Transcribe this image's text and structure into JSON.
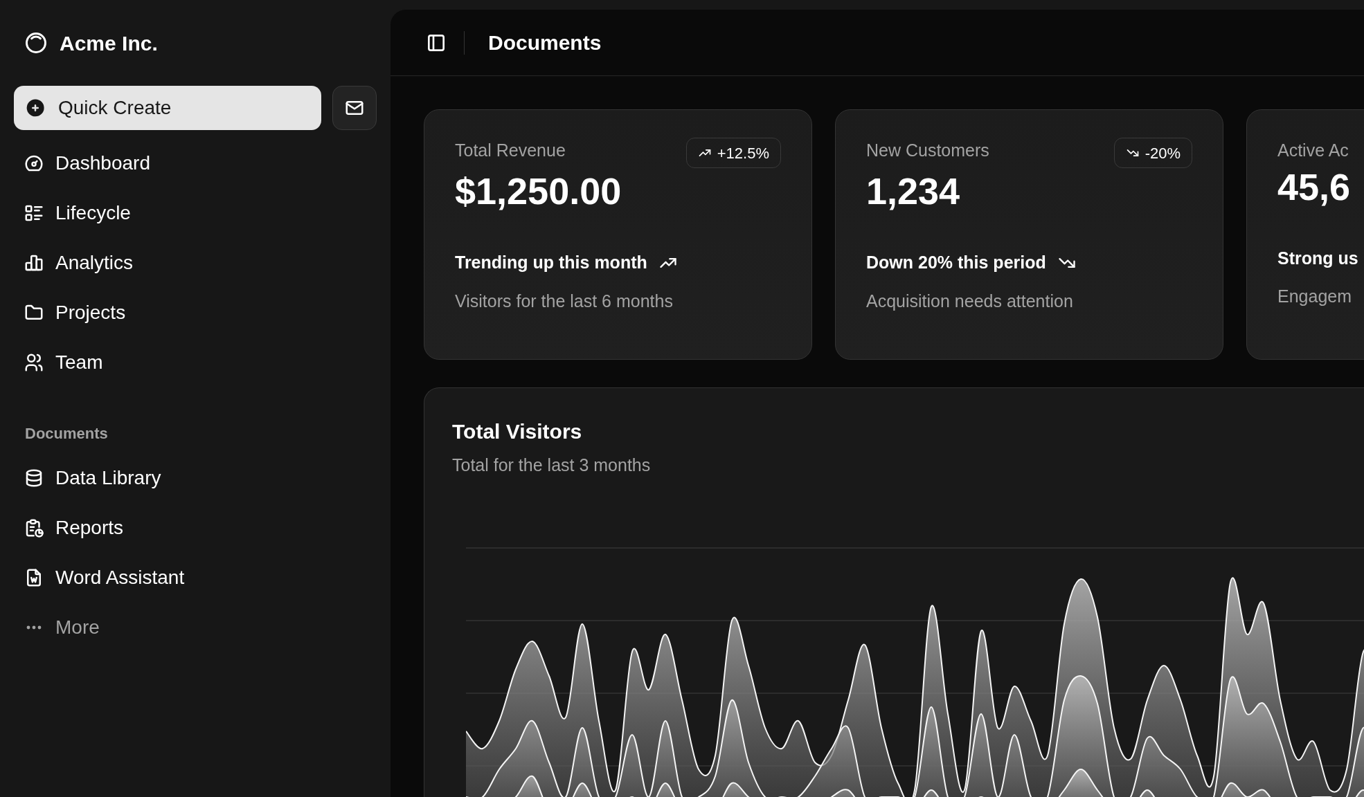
{
  "sidebar": {
    "brand": "Acme Inc.",
    "quick_create": "Quick Create",
    "nav_items": [
      {
        "label": "Dashboard"
      },
      {
        "label": "Lifecycle"
      },
      {
        "label": "Analytics"
      },
      {
        "label": "Projects"
      },
      {
        "label": "Team"
      }
    ],
    "documents_heading": "Documents",
    "document_items": [
      {
        "label": "Data Library",
        "kind": "link"
      },
      {
        "label": "Reports",
        "kind": "link"
      },
      {
        "label": "Word Assistant",
        "kind": "link"
      },
      {
        "label": "More",
        "kind": "more"
      }
    ]
  },
  "header": {
    "title": "Documents"
  },
  "cards": [
    {
      "label": "Total Revenue",
      "value": "$1,250.00",
      "badge": "+12.5%",
      "kind": "up",
      "headline": "Trending up this month",
      "note": "Visitors for the last 6 months"
    },
    {
      "label": "New Customers",
      "value": "1,234",
      "badge": "-20%",
      "kind": "down",
      "headline": "Down 20% this period",
      "note": "Acquisition needs attention"
    },
    {
      "label": "Active Ac",
      "value": "45,6",
      "headline": "Strong us",
      "note": "Engagem"
    }
  ],
  "visitors": {
    "title": "Total Visitors",
    "subtitle": "Total for the last 3 months"
  }
}
